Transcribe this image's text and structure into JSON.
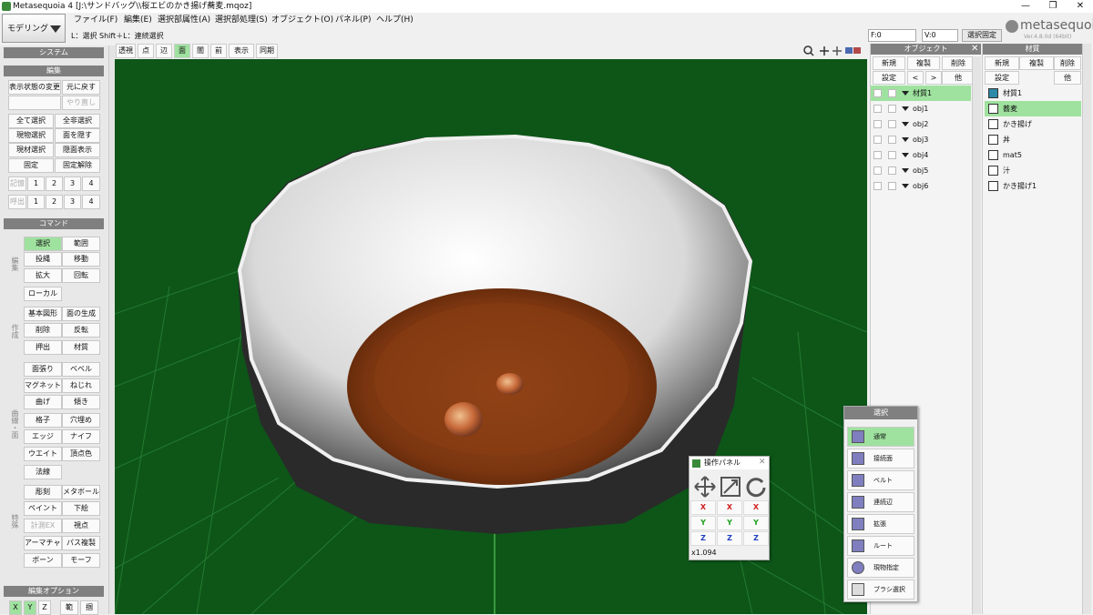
{
  "window": {
    "title": "Metasequoia 4 [J:\\サンドバッグ\\\\桜エビのかき揚げ蕎麦.mqoz]",
    "minimize": "—",
    "maximize": "❐",
    "close": "✕"
  },
  "mode": {
    "label": "モデリング"
  },
  "menu": [
    "ファイル(F)",
    "編集(E)",
    "選択部属性(A)",
    "選択部処理(S)",
    "オブジェクト(O)",
    "パネル(P)",
    "ヘルプ(H)"
  ],
  "status": "L：選択  Shift＋L：連続選択",
  "fields": {
    "f": "F:0",
    "v": "V:0",
    "selfix": "選択固定"
  },
  "logo": {
    "text": "metasequoia",
    "num": "4",
    "sub": "Ver.4.8.0d (64bit)"
  },
  "left": {
    "system": "システム",
    "edit": "編集",
    "edit_buttons": [
      "表示状態の変更",
      "元に戻す",
      "やり直し",
      "全て選択",
      "全非選択",
      "現物選択",
      "面を隠す",
      "現材選択",
      "隠面表示",
      "固定",
      "固定解除"
    ],
    "memory": {
      "label": "記憶",
      "nums": [
        "1",
        "2",
        "3",
        "4"
      ]
    },
    "recall": {
      "label": "呼出",
      "nums": [
        "1",
        "2",
        "3",
        "4"
      ]
    },
    "command": "コマンド",
    "vlabels": [
      "編集",
      "作成",
      "面",
      "曲線・面",
      "変形",
      "特殊"
    ],
    "cmd_buttons": [
      "選択",
      "範囲",
      "投縄",
      "移動",
      "拡大",
      "回転",
      "ローカル",
      "基本図形",
      "面の生成",
      "削除",
      "反転",
      "押出",
      "材質",
      "面張り",
      "ベベル",
      "マグネット",
      "ねじれ",
      "曲げ",
      "傾き",
      "格子",
      "穴埋め",
      "エッジ",
      "ナイフ",
      "ウエイト",
      "頂点色",
      "法線",
      "彫刻",
      "メタボール",
      "ペイント",
      "下絵",
      "計測EX",
      "視点",
      "アーマチャー",
      "パス複製",
      "ボーン",
      "モーフ"
    ],
    "cmd_keys": [
      "S",
      "R",
      "G",
      "V",
      "Q",
      "C"
    ],
    "editopt": "編集オプション",
    "xyz": [
      "X",
      "Y",
      "Z"
    ],
    "opt_more": [
      "範",
      "掴"
    ]
  },
  "viewtabs": [
    "透視",
    "点",
    "辺",
    "面",
    "前",
    "表示",
    "局暗"
  ],
  "objects": {
    "title": "オブジェクト",
    "buttons": [
      "新規",
      "複製",
      "削除",
      "設定",
      "<",
      ">",
      "他"
    ],
    "rows": [
      "材質1",
      "obj1",
      "obj2",
      "obj3",
      "obj4",
      "obj5",
      "obj6"
    ]
  },
  "materials": {
    "title": "材質",
    "buttons": [
      "新規",
      "複製",
      "削除",
      "設定",
      "他"
    ],
    "rows": [
      "材質1",
      "蕎麦",
      "かき揚げ",
      "丼",
      "mat5",
      "汁",
      "かき揚げ1"
    ],
    "colors": [
      "#2a8aa8",
      "#ffffff",
      "#ffffff",
      "#ffffff",
      "#ffffff",
      "#ffffff",
      "#ffffff"
    ]
  },
  "oppanel": {
    "title": "操作パネル",
    "x": "X",
    "y": "Y",
    "z": "Z",
    "scale": "x1.094"
  },
  "selpanel": {
    "title": "選択",
    "items": [
      "通常",
      "接続面",
      "ベルト",
      "連続辺",
      "拡張",
      "ルート",
      "現物指定",
      "ブラシ選択"
    ]
  }
}
